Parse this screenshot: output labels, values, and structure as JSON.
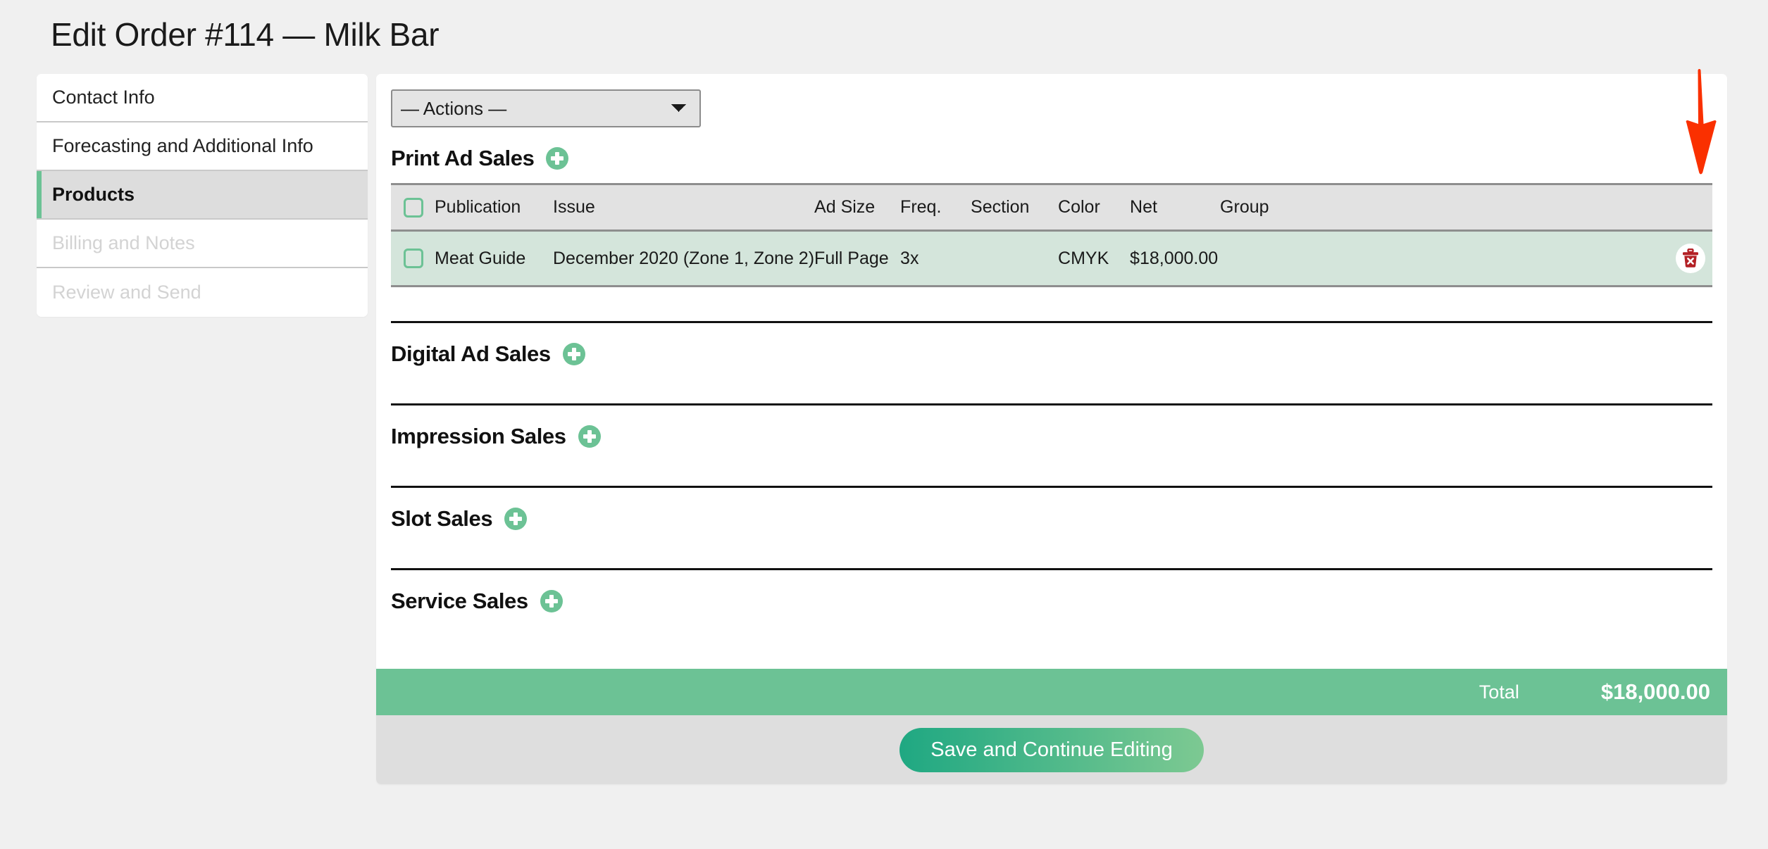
{
  "header": {
    "title": "Edit Order #114 — Milk Bar"
  },
  "sidebar": {
    "items": [
      {
        "label": "Contact Info",
        "state": "enabled"
      },
      {
        "label": "Forecasting and Additional Info",
        "state": "enabled"
      },
      {
        "label": "Products",
        "state": "active"
      },
      {
        "label": "Billing and Notes",
        "state": "disabled"
      },
      {
        "label": "Review and Send",
        "state": "disabled"
      }
    ]
  },
  "toolbar": {
    "actions_selected": "— Actions —",
    "actions_options": [
      "— Actions —"
    ]
  },
  "sections": {
    "print_ad_sales": {
      "title": "Print Ad Sales",
      "add_icon": "plus-circle-icon",
      "columns": [
        "Publication",
        "Issue",
        "Ad Size",
        "Freq.",
        "Section",
        "Color",
        "Net",
        "Group"
      ],
      "rows": [
        {
          "publication": "Meat Guide",
          "issue": "December 2020 (Zone 1, Zone 2)",
          "ad_size": "Full Page",
          "freq": "3x",
          "section": "",
          "color": "CMYK",
          "net": "$18,000.00",
          "group": "",
          "delete_icon": "trash-delete-icon"
        }
      ]
    },
    "digital_ad_sales": {
      "title": "Digital Ad Sales",
      "add_icon": "plus-circle-icon"
    },
    "impression_sales": {
      "title": "Impression Sales",
      "add_icon": "plus-circle-icon"
    },
    "slot_sales": {
      "title": "Slot Sales",
      "add_icon": "plus-circle-icon"
    },
    "service_sales": {
      "title": "Service Sales",
      "add_icon": "plus-circle-icon"
    }
  },
  "total": {
    "label": "Total",
    "value": "$18,000.00"
  },
  "footer": {
    "save_label": "Save and Continue Editing"
  },
  "annotation": {
    "arrow": "red-down-arrow",
    "arrow_color": "#FA3000"
  },
  "colors": {
    "accent_green": "#6cc295",
    "row_green": "#d4e5db",
    "header_gray": "#e2e2e2",
    "save_gradient_from": "#1fa882",
    "save_gradient_to": "#7dc992",
    "delete_red": "#b32025",
    "page_bg": "#f0f0f0"
  }
}
